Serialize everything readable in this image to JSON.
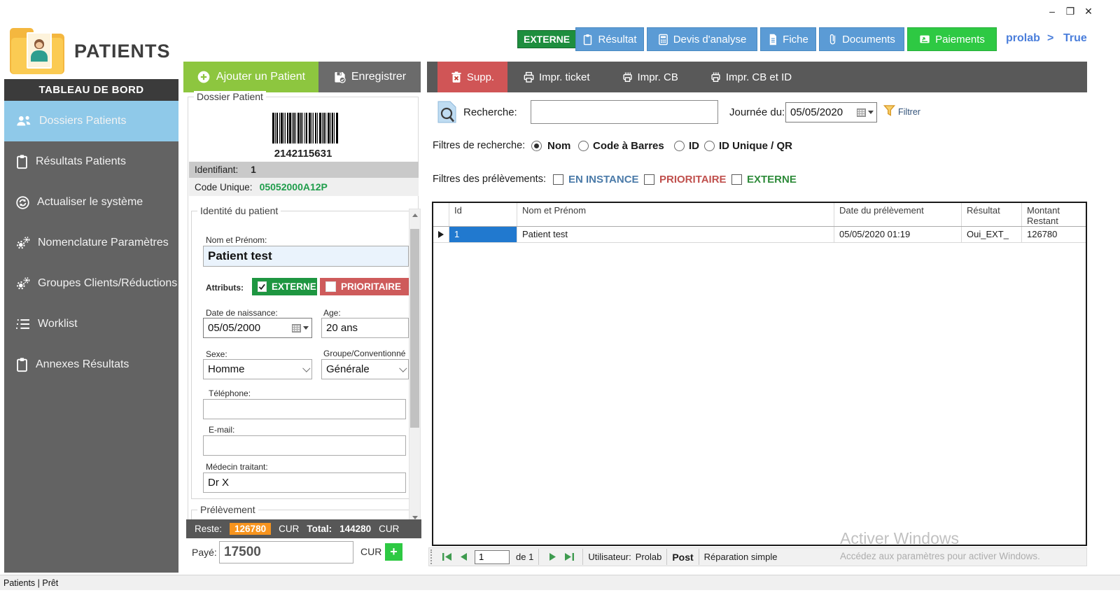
{
  "window": {
    "minimize": "–",
    "restore": "❐",
    "close": "✕"
  },
  "header": {
    "app_title": "PATIENTS",
    "badge": "EXTERNE",
    "nav": [
      {
        "label": "Résultat"
      },
      {
        "label": "Devis d'analyse"
      },
      {
        "label": "Fiche"
      },
      {
        "label": "Documents"
      },
      {
        "label": "Paiements"
      }
    ],
    "user": "prolab",
    "arrow": ">",
    "state": "True"
  },
  "sidebar": {
    "header": "TABLEAU DE BORD",
    "items": [
      {
        "label": "Dossiers Patients"
      },
      {
        "label": "Résultats Patients"
      },
      {
        "label": "Actualiser le système"
      },
      {
        "label": "Nomenclature Paramètres"
      },
      {
        "label": "Groupes Clients/Réductions"
      },
      {
        "label": "Worklist"
      },
      {
        "label": "Annexes Résultats"
      }
    ]
  },
  "patient_panel": {
    "add_label": "Ajouter un Patient",
    "save_label": "Enregistrer",
    "group_legend": "Dossier Patient",
    "barcode_value": "2142115631",
    "id_label": "Identifiant:",
    "id_value": "1",
    "code_label": "Code Unique:",
    "code_value": "05052000A12P",
    "identity_legend": "Identité du patient",
    "name_label": "Nom et Prénom:",
    "name_value": "Patient test",
    "attr_label": "Attributs:",
    "attr_externe": "EXTERNE",
    "attr_prioritaire": "PRIORITAIRE",
    "dob_label": "Date de naissance:",
    "dob_value": "05/05/2000",
    "age_label": "Age:",
    "age_value": "20 ans",
    "sex_label": "Sexe:",
    "sex_value": "Homme",
    "group_label": "Groupe/Conventionné",
    "group_value": "Générale",
    "phone_label": "Téléphone:",
    "email_label": "E-mail:",
    "doctor_label": "Médecin traitant:",
    "doctor_value": "Dr X",
    "prelev_legend": "Prélèvement",
    "reste_label": "Reste:",
    "reste_value": "126780",
    "cur1": "CUR",
    "total_label": "Total:",
    "total_value": "144280",
    "cur2": "CUR",
    "paye_label": "Payé:",
    "paye_value": "17500",
    "paye_cur": "CUR",
    "plus_label": "+"
  },
  "results_panel": {
    "toolbar": {
      "supp": "Supp.",
      "print_ticket": "Impr. ticket",
      "print_cb": "Impr. CB",
      "print_cb_id": "Impr. CB et ID"
    },
    "search_label": "Recherche:",
    "journee_label": "Journée du:",
    "journee_value": "05/05/2020",
    "filter_label": "Filtrer",
    "rf_label": "Filtres de recherche:",
    "rf_options": [
      {
        "label": "Nom"
      },
      {
        "label": "Code à Barres"
      },
      {
        "label": "ID"
      },
      {
        "label": "ID Unique / QR"
      }
    ],
    "pf_label": "Filtres des prélèvements:",
    "pf_options": [
      {
        "label": "EN INSTANCE",
        "color": "#4a7aa8"
      },
      {
        "label": "PRIORITAIRE",
        "color": "#C0504D"
      },
      {
        "label": "EXTERNE",
        "color": "#2E8B3A"
      }
    ],
    "table": {
      "columns": [
        "Id",
        "Nom et Prénom",
        "Date du prélèvement",
        "Résultat",
        "Montant Restant"
      ],
      "rows": [
        {
          "id": "1",
          "name": "Patient test",
          "date": "05/05/2020 01:19",
          "result": "Oui_EXT_",
          "montant": "126780"
        }
      ]
    },
    "pager": {
      "page": "1",
      "of": "de 1",
      "user_label": "Utilisateur:",
      "user": "Prolab",
      "post": "Post",
      "mode": "Réparation simple"
    },
    "watermark_1": "Activer Windows",
    "watermark_2": "Accédez aux paramètres pour activer Windows."
  },
  "statusbar": {
    "text": "Patients | Prêt"
  }
}
